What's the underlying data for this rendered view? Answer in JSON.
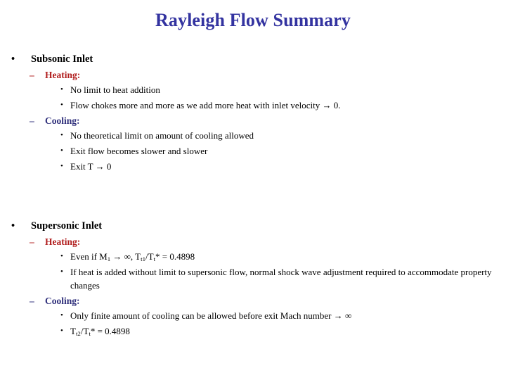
{
  "slide": {
    "title": "Rayleigh Flow Summary",
    "title_color": "#3333a0",
    "background_color": "#ffffff",
    "heading_color": "#b22020",
    "cooling_color": "#2e2e7a",
    "body_color": "#000000",
    "bullet_glyphs": {
      "level1": "•",
      "level2": "–",
      "level3": "•"
    }
  },
  "sections": [
    {
      "heading": "Subsonic Inlet",
      "groups": [
        {
          "label": "Heating:",
          "color_role": "heating",
          "items": [
            "No limit to heat addition",
            "Flow chokes more and more as we add more heat with inlet velocity → 0."
          ]
        },
        {
          "label": "Cooling:",
          "color_role": "cooling",
          "items": [
            "No theoretical limit on amount of cooling allowed",
            "Exit flow becomes slower and slower",
            "Exit T → 0"
          ]
        }
      ]
    },
    {
      "heading": "Supersonic Inlet",
      "groups": [
        {
          "label": "Heating:",
          "color_role": "heating",
          "items": [
            "Even if M₁ → ∞, Tₜ₁/Tₜ* = 0.4898",
            "If heat is added without limit to supersonic flow, normal shock wave adjustment required to accommodate property changes"
          ]
        },
        {
          "label": "Cooling:",
          "color_role": "cooling",
          "items": [
            "Only finite amount of cooling can be allowed before exit Mach number → ∞",
            "Tₜ₂/Tₜ* = 0.4898"
          ]
        }
      ]
    }
  ],
  "formulas": {
    "even_if": {
      "prefix": "Even if M",
      "m_sub": "1",
      "mid": " → ∞, T",
      "t1_sub": "t1",
      "slash": "/T",
      "t_sub": "t",
      "suffix": "* = 0.4898"
    },
    "tt2": {
      "prefix": "T",
      "t2_sub": "t2",
      "slash": "/T",
      "t_sub": "t",
      "suffix": "* = 0.4898"
    }
  }
}
